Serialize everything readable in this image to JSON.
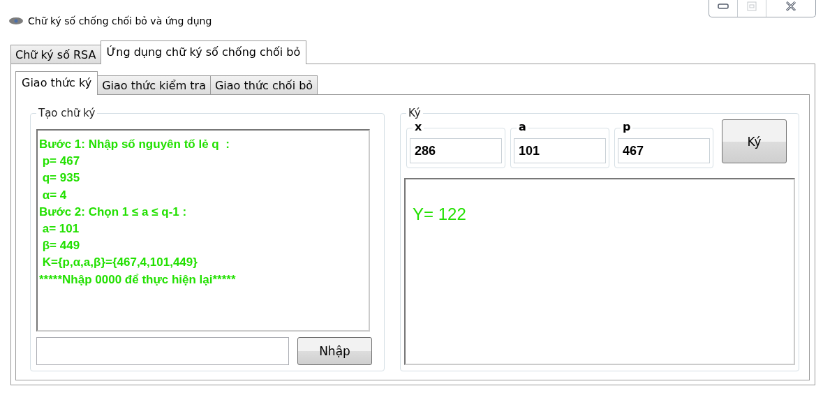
{
  "window": {
    "title": "Chữ ký số chống chối bỏ và ứng dụng",
    "controls": [
      {
        "kind": "minimize",
        "disabled": false
      },
      {
        "kind": "maximize",
        "disabled": true
      },
      {
        "kind": "close",
        "disabled": false
      }
    ]
  },
  "tabs": [
    {
      "label": "Chữ ký số RSA",
      "selected": false
    },
    {
      "label": "Ứng dụng chữ ký số chống chối bỏ",
      "selected": true
    }
  ],
  "subtabs": [
    {
      "label": "Giao thức ký",
      "selected": true
    },
    {
      "label": "Giao thức kiểm tra",
      "selected": false
    },
    {
      "label": "Giao thức chối bỏ",
      "selected": false
    }
  ],
  "create_group": {
    "title": "Tạo chữ ký",
    "log_lines": [
      "Bước 1: Nhập số nguyên tố lẻ q  :",
      " p= 467",
      " q= 935",
      " α= 4",
      "Bước 2: Chọn 1 ≤ a ≤ q-1 :",
      " a= 101",
      " β= 449",
      " K={p,α,a,β}={467,4,101,449}",
      "*****Nhập 0000 để thực hiện lại*****"
    ],
    "button": "Nhập"
  },
  "sign_group": {
    "title": "Ký",
    "fields": [
      {
        "label": "x",
        "value": "286"
      },
      {
        "label": "a",
        "value": "101"
      },
      {
        "label": "p",
        "value": "467"
      }
    ],
    "button": "Ký",
    "result": "Y= 122"
  }
}
